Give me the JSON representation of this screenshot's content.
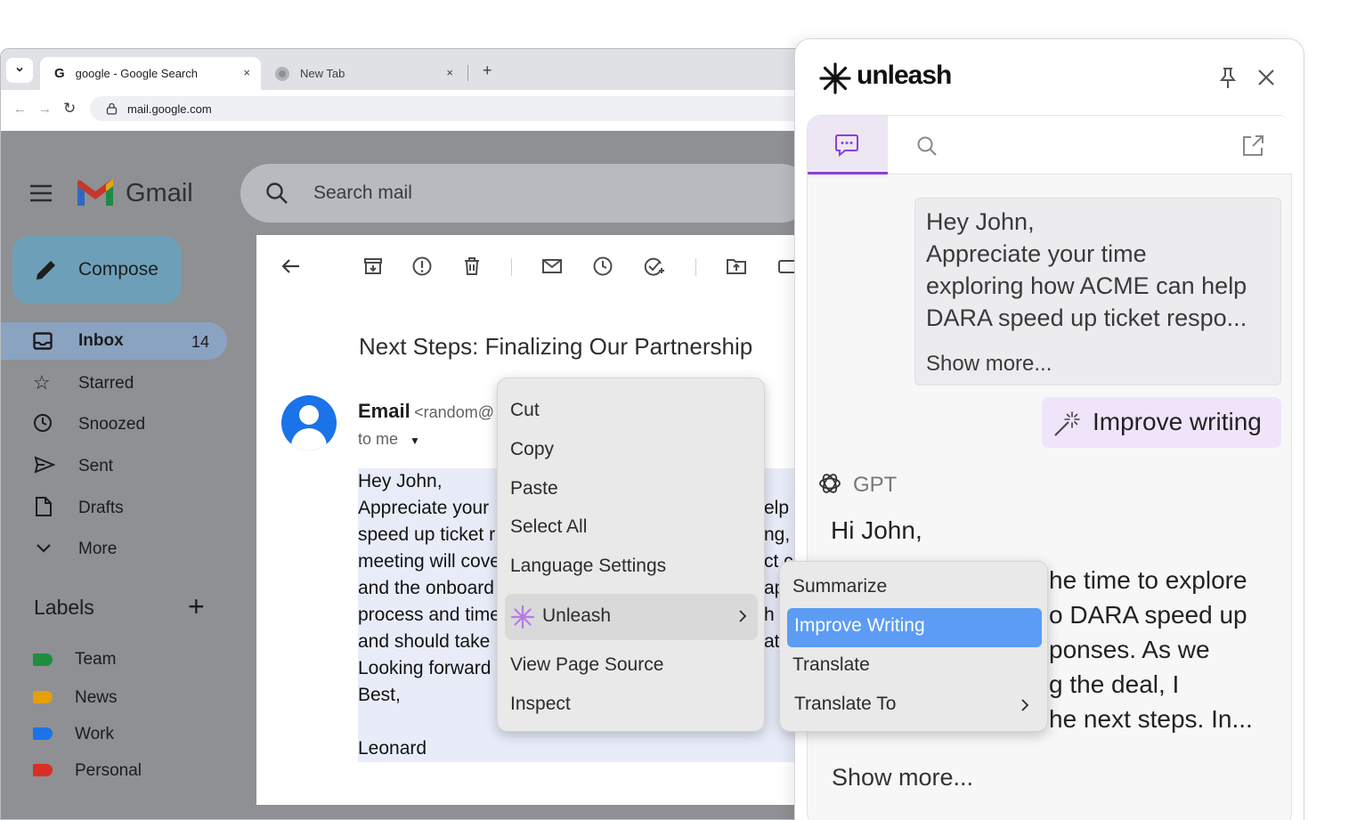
{
  "browser": {
    "tabs": [
      {
        "title": "google - Google Search",
        "close": "×"
      },
      {
        "title": "New Tab",
        "close": "×"
      }
    ],
    "new_tab": "+",
    "dropdown": "⌄",
    "url": "mail.google.com"
  },
  "gmail": {
    "logo_text": "Gmail",
    "search_placeholder": "Search mail",
    "compose": "Compose",
    "nav": [
      {
        "label": "Inbox",
        "count": "14"
      },
      {
        "label": "Starred"
      },
      {
        "label": "Snoozed"
      },
      {
        "label": "Sent"
      },
      {
        "label": "Drafts"
      },
      {
        "label": "More"
      }
    ],
    "labels_heading": "Labels",
    "labels": [
      {
        "name": "Team",
        "color": "#1e8e3e"
      },
      {
        "name": "News",
        "color": "#e3a008"
      },
      {
        "name": "Work",
        "color": "#1a73e8"
      },
      {
        "name": "Personal",
        "color": "#d93025"
      }
    ]
  },
  "email": {
    "subject": "Next Steps: Finalizing Our Partnership",
    "sender_name": "Email",
    "sender_addr": "<random@",
    "to": "to me",
    "body_left": [
      "Hey John,",
      "Appreciate your",
      "speed up ticket r",
      "meeting will cove",
      "and the onboard",
      "process and time",
      "and should take",
      "Looking forward",
      "Best,",
      "",
      "Leonard"
    ],
    "body_right": [
      "",
      "elp",
      "ng, c",
      "ct c",
      "ap",
      "h",
      "at",
      "",
      "",
      "",
      ""
    ]
  },
  "context_menu": {
    "items": [
      "Cut",
      "Copy",
      "Paste",
      "Select All",
      "Language Settings"
    ],
    "unleash": "Unleash",
    "items2": [
      "View Page Source",
      "Inspect"
    ]
  },
  "submenu": {
    "items": [
      "Summarize",
      "Improve Writing",
      "Translate",
      "Translate To"
    ],
    "selected": "Improve Writing"
  },
  "unleash": {
    "brand": "unleash",
    "user_message": [
      "Hey John,",
      "Appreciate your time",
      "exploring how ACME can help",
      "DARA speed up ticket respo..."
    ],
    "show_more": "Show more...",
    "action": "Improve writing",
    "model": "GPT",
    "reply_greeting": "Hi John,",
    "reply_lines": [
      "he time to explore",
      "o DARA speed up",
      "ponses. As we",
      "g the deal, I",
      "he next steps. In..."
    ],
    "reply_show_more": "Show more...",
    "accent": "#8b3fd9"
  }
}
